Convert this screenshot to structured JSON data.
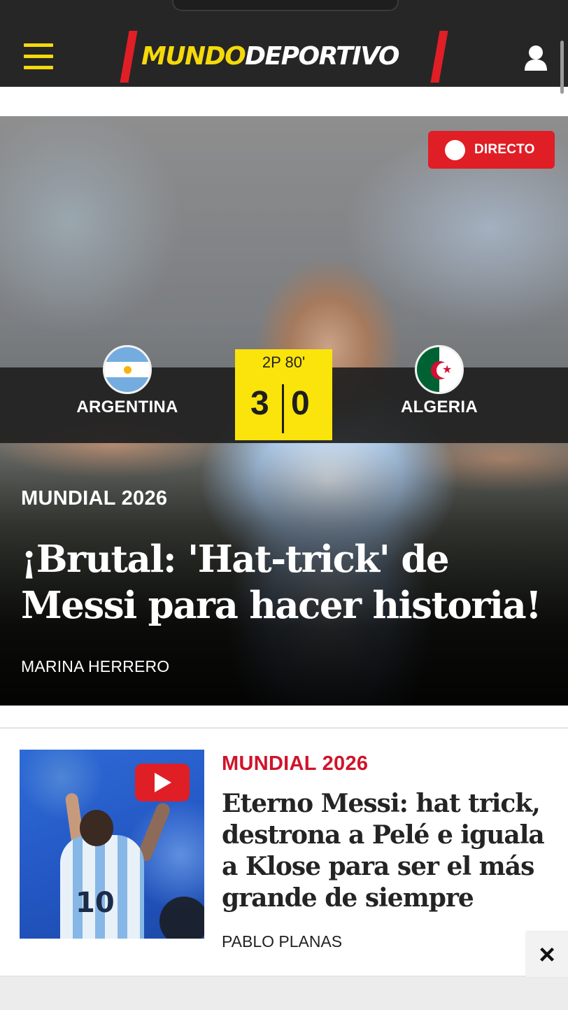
{
  "header": {
    "logo_part1": "MUNDO",
    "logo_part2": "DEPORTIVO",
    "menu_icon": "hamburger-menu-icon",
    "user_icon": "user-icon",
    "colors": {
      "background": "#262626",
      "brand_yellow": "#f5d90a",
      "brand_red": "#e01e26"
    }
  },
  "hero": {
    "live_label": "DIRECTO",
    "match": {
      "home_team": "ARGENTINA",
      "away_team": "ALGERIA",
      "period": "2P 80'",
      "home_score": "3",
      "away_score": "0",
      "home_flag": "argentina-flag-icon",
      "away_flag": "algeria-flag-icon"
    },
    "kicker": "MUNDIAL 2026",
    "title": "¡Brutal: 'Hat-trick' de Messi para hacer historia!",
    "author": "MARINA HERRERO"
  },
  "article2": {
    "kicker": "MUNDIAL 2026",
    "title": "Eterno Messi: hat trick, destrona a Pelé e iguala a Klose para ser el más grande de siempre",
    "author": "PABLO PLANAS",
    "thumbnail_number": "10",
    "video_icon": "play-icon",
    "kicker_color": "#d0142a"
  },
  "ad": {
    "close_label": "×",
    "close_icon": "close-icon"
  }
}
